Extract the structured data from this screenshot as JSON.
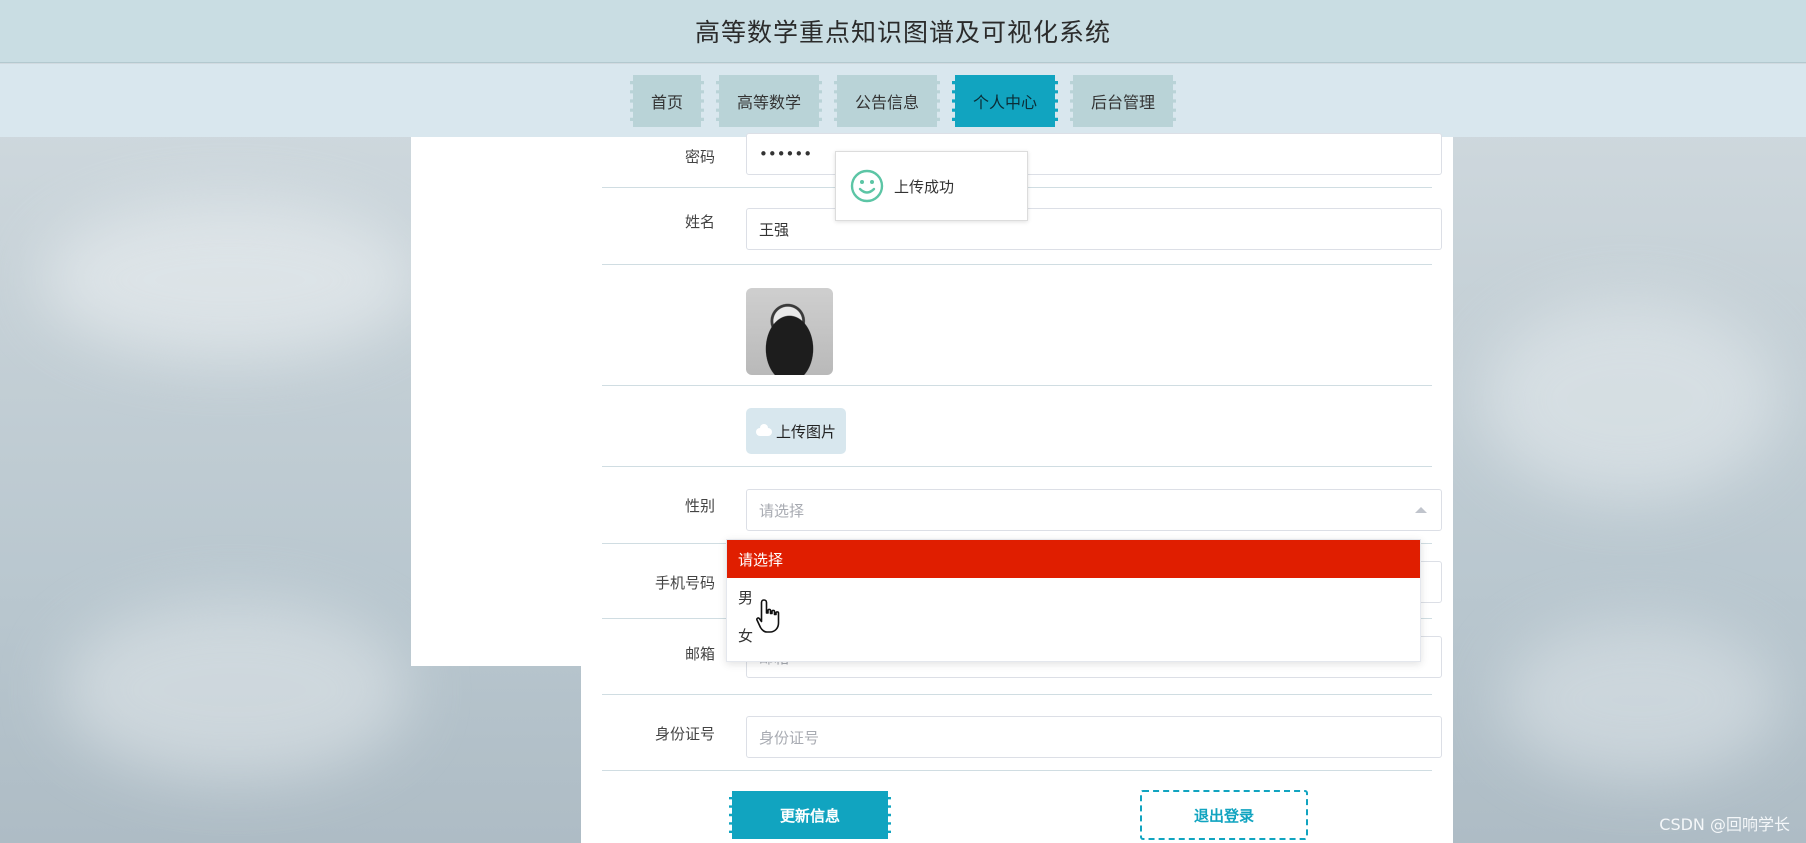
{
  "header": {
    "title": "高等数学重点知识图谱及可视化系统"
  },
  "nav": {
    "items": [
      {
        "label": "首页"
      },
      {
        "label": "高等数学"
      },
      {
        "label": "公告信息"
      },
      {
        "label": "个人中心"
      },
      {
        "label": "后台管理"
      }
    ],
    "active_index": 3
  },
  "form": {
    "password": {
      "label": "密码",
      "value": "••••••"
    },
    "name": {
      "label": "姓名",
      "value": "王强"
    },
    "upload_button": {
      "label": "上传图片"
    },
    "gender": {
      "label": "性别",
      "placeholder": "请选择"
    },
    "phone": {
      "label": "手机号码"
    },
    "email": {
      "label": "邮箱",
      "placeholder": "邮箱"
    },
    "id_card": {
      "label": "身份证号",
      "placeholder": "身份证号"
    }
  },
  "gender_dropdown": {
    "options": [
      "请选择",
      "男",
      "女"
    ],
    "selected_index": 0
  },
  "toast": {
    "message": "上传成功"
  },
  "buttons": {
    "update": "更新信息",
    "logout": "退出登录"
  },
  "watermark": "CSDN @回响学长",
  "colors": {
    "accent": "#11a4c0",
    "selected_option": "#e01e00",
    "header_bg": "#c9dde3",
    "nav_bg": "#d9e7ee"
  },
  "icons": [
    "smile-icon",
    "cloud-upload-icon",
    "caret-up-icon",
    "hand-cursor-icon"
  ]
}
